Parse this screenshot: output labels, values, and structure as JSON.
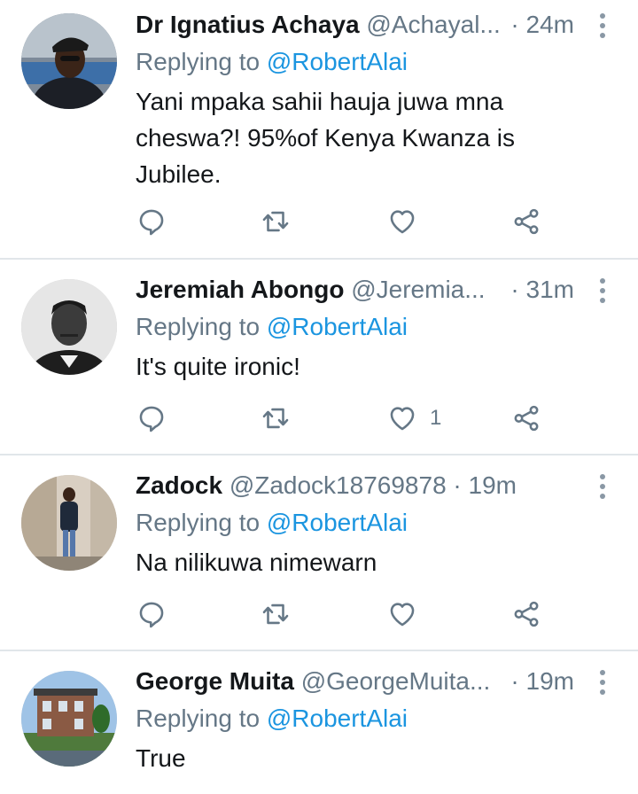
{
  "tweets": [
    {
      "name": "Dr Ignatius Achaya",
      "handle": "@Achayal...",
      "separator": "·",
      "time": "24m",
      "replying_prefix": "Replying to",
      "replying_to": "@RobertAlai",
      "text": "Yani mpaka sahii hauja juwa mna cheswa?! 95%of Kenya Kwanza is Jubilee.",
      "like_count": ""
    },
    {
      "name": "Jeremiah Abongo",
      "handle": "@Jeremia...",
      "separator": "·",
      "time": "31m",
      "replying_prefix": "Replying to",
      "replying_to": "@RobertAlai",
      "text": "It's quite ironic!",
      "like_count": "1"
    },
    {
      "name": "Zadock",
      "handle": "@Zadock18769878",
      "separator": "·",
      "time": "19m",
      "replying_prefix": "Replying to",
      "replying_to": "@RobertAlai",
      "text": "Na nilikuwa nimewarn",
      "like_count": ""
    },
    {
      "name": "George Muita",
      "handle": "@GeorgeMuita...",
      "separator": "·",
      "time": "19m",
      "replying_prefix": "Replying to",
      "replying_to": "@RobertAlai",
      "text": "True",
      "like_count": ""
    }
  ],
  "icons": {
    "reply": "reply-icon",
    "retweet": "retweet-icon",
    "like": "heart-icon",
    "share": "share-icon",
    "more": "more-vertical-icon"
  },
  "colors": {
    "link": "#1b95e0",
    "secondary_text": "#657786",
    "icon": "#657786",
    "divider": "#e1e6ea"
  }
}
